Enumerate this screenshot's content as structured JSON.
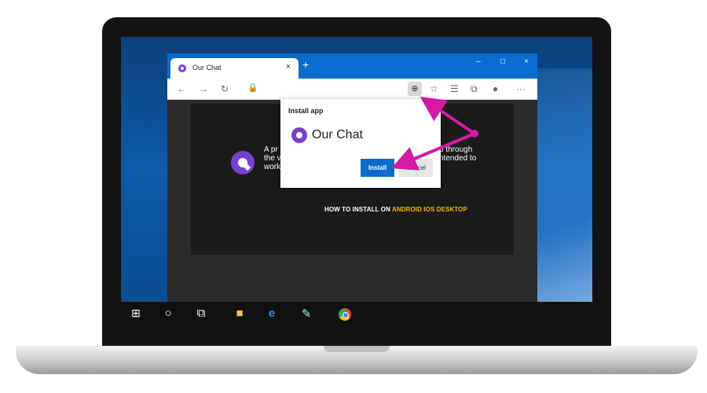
{
  "browser": {
    "tab_title": "Our Chat",
    "tab_close": "×",
    "new_tab": "+",
    "window_controls": {
      "minimize": "–",
      "maximize": "□",
      "close": "×"
    },
    "toolbar": {
      "back": "←",
      "forward": "→",
      "refresh": "↻",
      "more": "···"
    }
  },
  "popup": {
    "title": "Install app",
    "app_name": "Our Chat",
    "install_label": "Install",
    "cancel_label": "Cancel"
  },
  "content": {
    "description_left": "A pr\nthe v\nwork",
    "description_right": "d through\nntended to",
    "howto_prefix": "HOW TO INSTALL ON ",
    "howto_platforms": "ANDROID IOS DESKTOP"
  },
  "taskbar": {
    "start_icon": "windows-logo",
    "items": [
      "search",
      "task-view",
      "file-explorer",
      "edge",
      "paint",
      "chrome"
    ]
  },
  "colors": {
    "accent_blue": "#0b6cd0",
    "brand_purple": "#7a3fd1",
    "arrow_magenta": "#d21aa5",
    "highlight_yellow": "#f5b400"
  }
}
